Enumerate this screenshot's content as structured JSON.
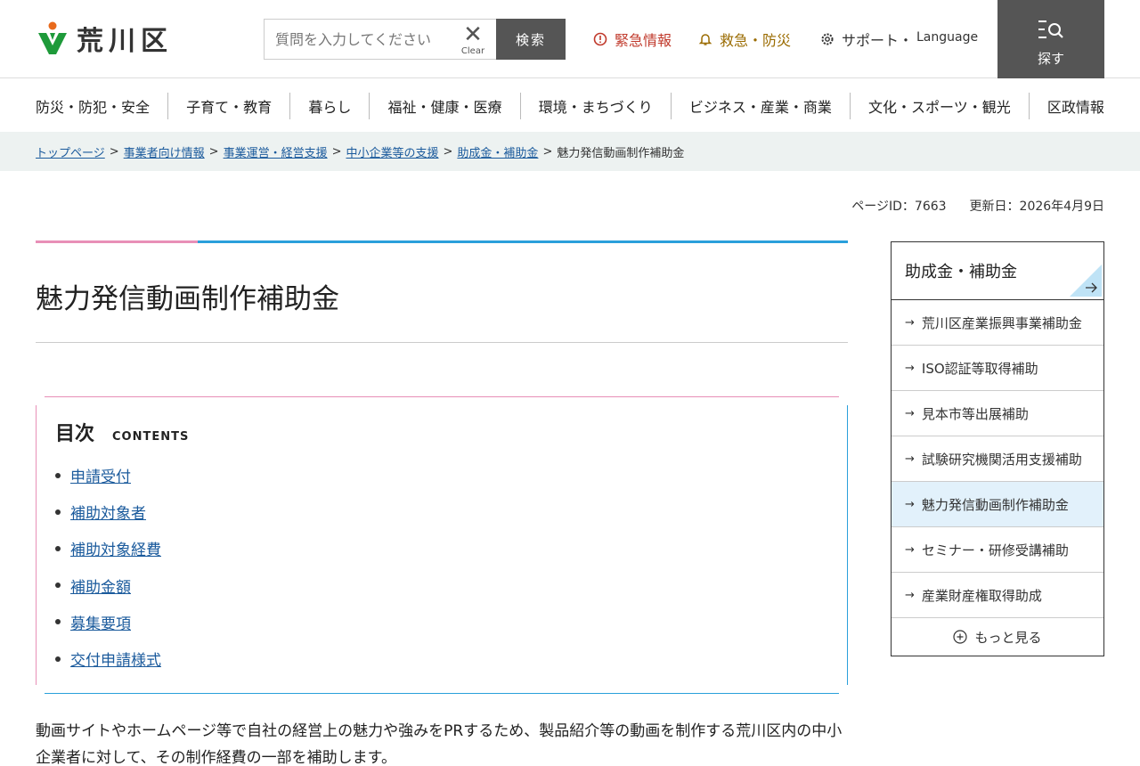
{
  "header": {
    "logo_text": "荒川区",
    "search_placeholder": "質問を入力してください",
    "clear_label": "Clear",
    "search_button": "検索",
    "emergency": "緊急情報",
    "rescue": "救急・防災",
    "support": "サポート・",
    "language": "Language",
    "find": "探す"
  },
  "gnav": [
    "防災・防犯・安全",
    "子育て・教育",
    "暮らし",
    "福祉・健康・医療",
    "環境・まちづくり",
    "ビジネス・産業・商業",
    "文化・スポーツ・観光",
    "区政情報"
  ],
  "breadcrumb": {
    "links": [
      "トップページ",
      "事業者向け情報",
      "事業運営・経営支援",
      "中小企業等の支援",
      "助成金・補助金"
    ],
    "current": "魅力発信動画制作補助金",
    "separator": ">"
  },
  "meta": {
    "page_id": "ページID：7663",
    "updated": "更新日：2026年4月9日"
  },
  "page_title": "魅力発信動画制作補助金",
  "toc": {
    "title": "目次",
    "subtitle": "CONTENTS",
    "items": [
      "申請受付",
      "補助対象者",
      "補助対象経費",
      "補助金額",
      "募集要項",
      "交付申請様式"
    ]
  },
  "intro": "動画サイトやホームページ等で自社の経営上の魅力や強みをPRするため、製品紹介等の動画を制作する荒川区内の中小企業者に対して、その制作経費の一部を補助します。",
  "side": {
    "heading": "助成金・補助金",
    "items": [
      "荒川区産業振興事業補助金",
      "ISO認証等取得補助",
      "見本市等出展補助",
      "試験研究機関活用支援補助",
      "魅力発信動画制作補助金",
      "セミナー・研修受講補助",
      "産業財産権取得助成"
    ],
    "active_index": 4,
    "more": "もっと見る"
  },
  "colors": {
    "accent_blue": "#2aa0db",
    "accent_pink": "#e88fb7",
    "logo_green": "#1e9a3a",
    "logo_orange": "#e86a1c",
    "emergency_red": "#c0392b",
    "rescue_gold": "#9a6b00"
  }
}
